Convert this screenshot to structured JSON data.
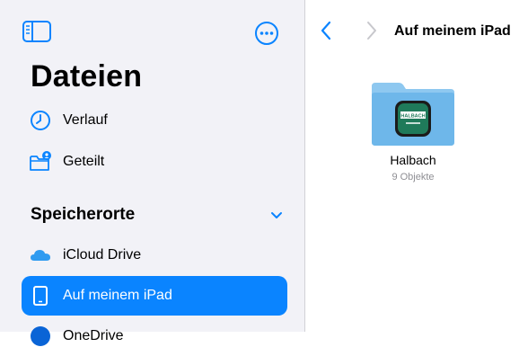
{
  "sidebar": {
    "title": "Dateien",
    "toggle_icon": "sidebar-toggle-icon",
    "more_icon": "ellipsis-circle-icon",
    "items": [
      {
        "label": "Verlauf",
        "icon": "clock-icon"
      },
      {
        "label": "Geteilt",
        "icon": "shared-folder-icon"
      }
    ],
    "section": {
      "label": "Speicherorte",
      "chevron_icon": "chevron-down-icon",
      "locations": [
        {
          "label": "iCloud Drive",
          "icon": "icloud-icon",
          "selected": false
        },
        {
          "label": "Auf meinem iPad",
          "icon": "ipad-icon",
          "selected": true
        },
        {
          "label": "OneDrive",
          "icon": "onedrive-icon",
          "selected": false
        }
      ]
    }
  },
  "main": {
    "back_icon": "chevron-left-icon",
    "forward_icon": "chevron-right-icon",
    "title": "Auf meinem iPad",
    "folders": [
      {
        "name": "Halbach",
        "count": "9 Objekte",
        "badge_text": "HALBACH",
        "icon": "folder-icon"
      }
    ]
  },
  "colors": {
    "accent": "#0a84ff",
    "sidebar_bg": "#f2f2f7",
    "folder": "#74b9e8",
    "badge_bg": "#1f7a5a"
  }
}
